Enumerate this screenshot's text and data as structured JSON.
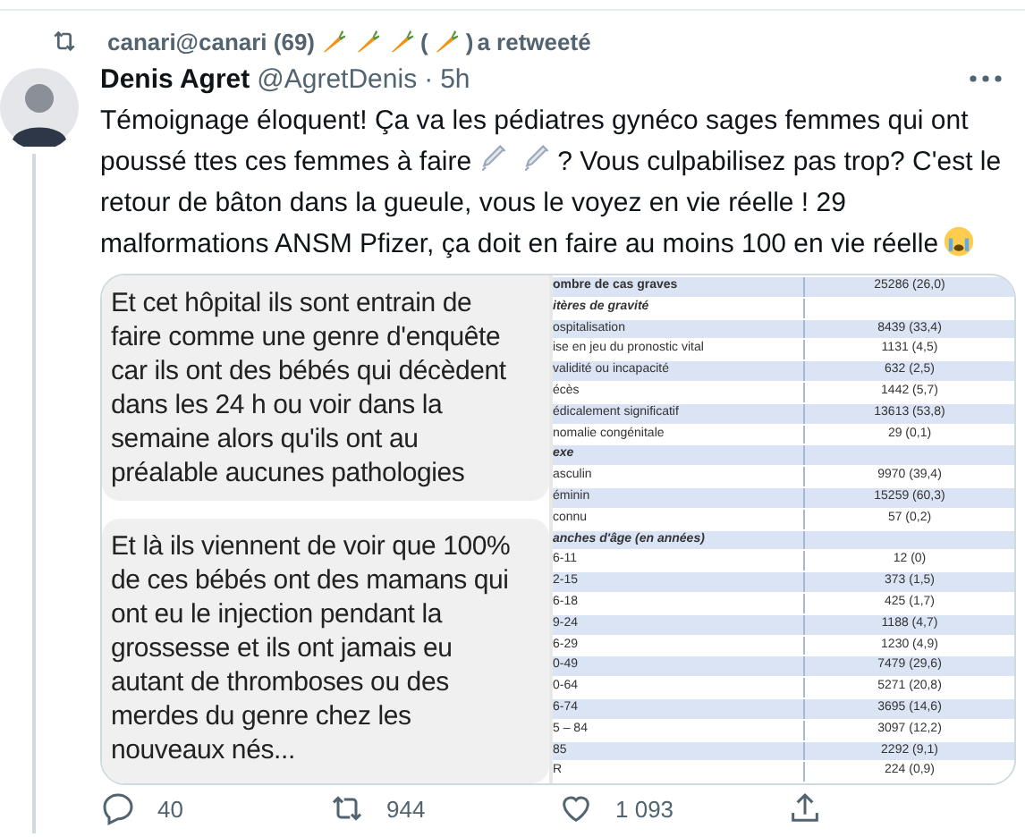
{
  "retweet": {
    "user": "canari@canari (69)",
    "open_paren": "(",
    "close_paren": ")",
    "action": "a retweeté"
  },
  "author": {
    "name": "Denis Agret",
    "handle": "@AgretDenis",
    "separator": "·",
    "time": "5h"
  },
  "tweet_text": [
    "Témoignage éloquent! Ça va les pédiatres gynéco sages femmes qui ont",
    "poussé ttes ces femmes à faire",
    "? Vous culpabilisez pas trop? C'est le",
    "retour de bâton dans la gueule, vous le voyez en vie réelle ! 29",
    "malformations ANSM Pfizer, ça doit en faire au moins 100 en vie réelle"
  ],
  "image": {
    "messages": [
      {
        "lines": [
          "Et cet hôpital ils sont entrain de",
          "faire comme une genre d'enquête",
          "car ils ont des bébés qui décèdent",
          "dans les 24 h ou voir dans la",
          "semaine alors qu'ils ont au",
          "préalable aucunes pathologies"
        ]
      },
      {
        "lines": [
          "Et là ils viennent de voir que 100%",
          "de ces bébés ont des mamans qui",
          "ont eu le injection pendant la",
          "grossesse et ils ont jamais eu",
          "autant de thromboses ou des",
          "merdes du genre chez les",
          "nouveaux nés..."
        ]
      }
    ],
    "table_rows": [
      {
        "kind": "header",
        "label": "ombre de cas graves",
        "value": "25286 (26,0)"
      },
      {
        "kind": "section",
        "label": "itères de gravité"
      },
      {
        "kind": "row",
        "label": "ospitalisation",
        "value": "8439 (33,4)"
      },
      {
        "kind": "row",
        "label": "ise en jeu du pronostic vital",
        "value": "1131 (4,5)"
      },
      {
        "kind": "row",
        "label": "validité ou incapacité",
        "value": "632 (2,5)"
      },
      {
        "kind": "row",
        "label": "écès",
        "value": "1442 (5,7)"
      },
      {
        "kind": "row",
        "label": "édicalement significatif",
        "value": "13613 (53,8)"
      },
      {
        "kind": "row",
        "label": "nomalie congénitale",
        "value": "29 (0,1)"
      },
      {
        "kind": "section",
        "label": "exe"
      },
      {
        "kind": "row",
        "label": "asculin",
        "value": "9970 (39,4)"
      },
      {
        "kind": "row",
        "label": "éminin",
        "value": "15259 (60,3)"
      },
      {
        "kind": "row",
        "label": "connu",
        "value": "57 (0,2)"
      },
      {
        "kind": "section",
        "label": "anches d'âge (en années)"
      },
      {
        "kind": "row",
        "label": "6-11",
        "value": "12 (0)"
      },
      {
        "kind": "row",
        "label": "2-15",
        "value": "373 (1,5)"
      },
      {
        "kind": "row",
        "label": "6-18",
        "value": "425 (1,7)"
      },
      {
        "kind": "row",
        "label": "9-24",
        "value": "1188 (4,7)"
      },
      {
        "kind": "row",
        "label": "6-29",
        "value": "1230 (4,9)"
      },
      {
        "kind": "row",
        "label": "0-49",
        "value": "7479 (29,6)"
      },
      {
        "kind": "row",
        "label": "0-64",
        "value": "5271 (20,8)"
      },
      {
        "kind": "row",
        "label": "6-74",
        "value": "3695 (14,6)"
      },
      {
        "kind": "row",
        "label": "5 – 84",
        "value": "3097 (12,2)"
      },
      {
        "kind": "row",
        "label": "85",
        "value": "2292 (9,1)"
      },
      {
        "kind": "row",
        "label": "R",
        "value": "224 (0,9)"
      }
    ]
  },
  "actions": [
    {
      "kind": "reply",
      "count": "40"
    },
    {
      "kind": "retweet",
      "count": "944"
    },
    {
      "kind": "like",
      "count": "1 093"
    },
    {
      "kind": "share"
    }
  ]
}
